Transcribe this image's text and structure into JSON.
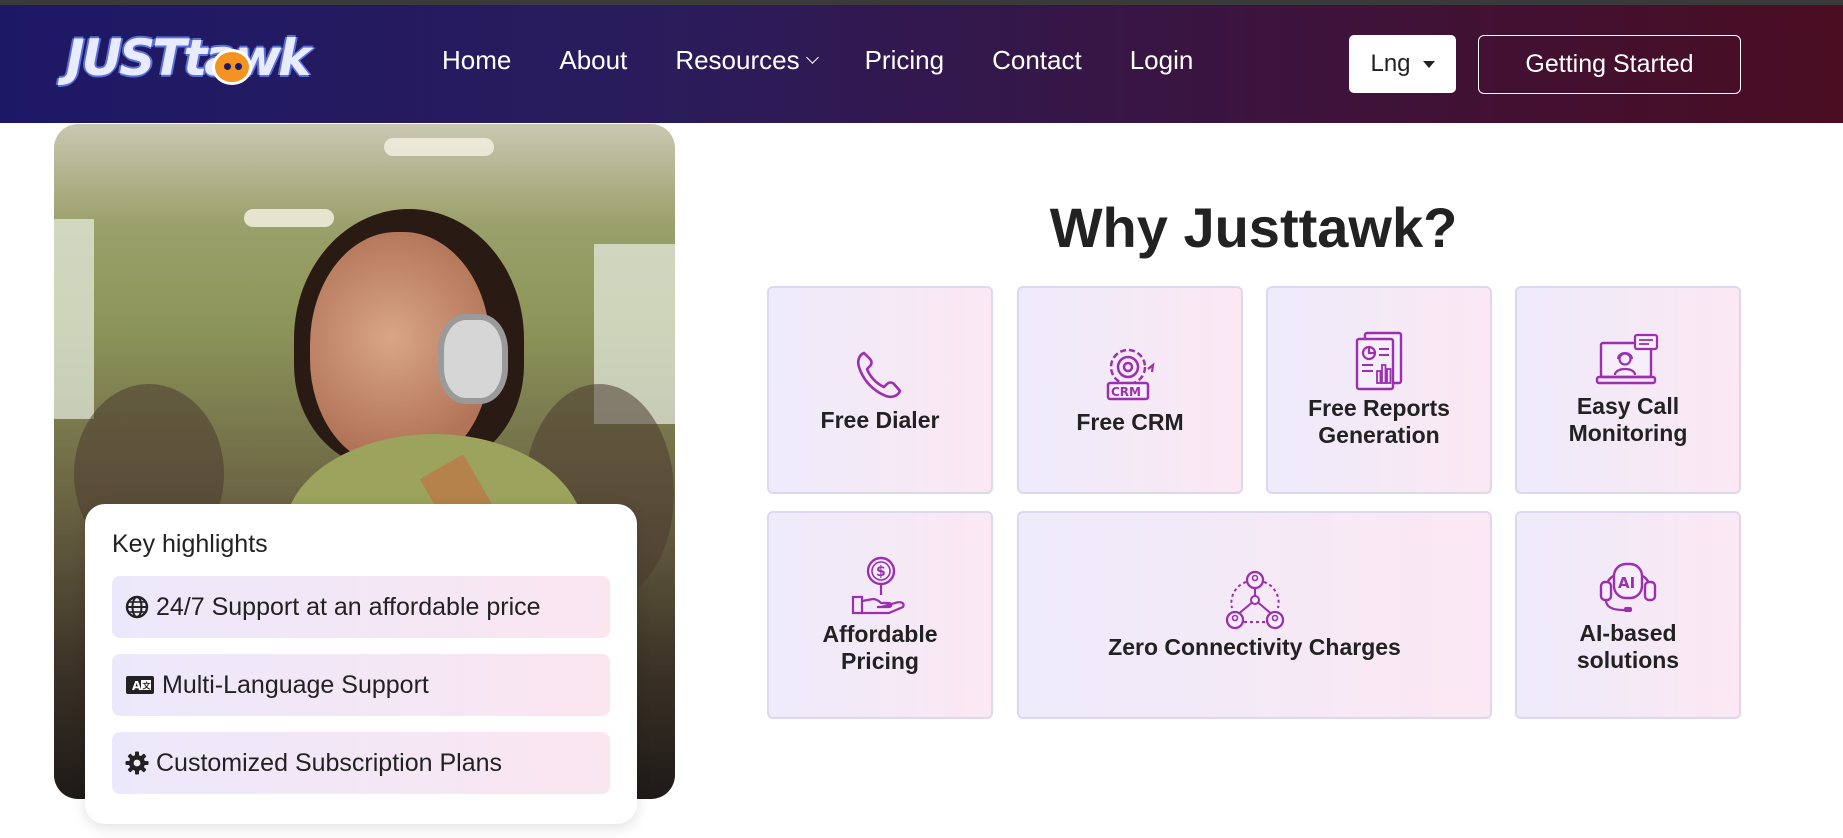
{
  "brand": {
    "logo_text": "JUSTtawk",
    "accent_gradient": [
      "#1d1866",
      "#4a0d22"
    ],
    "icon_color": "#9b2fae"
  },
  "nav": {
    "items": [
      {
        "label": "Home"
      },
      {
        "label": "About"
      },
      {
        "label": "Resources",
        "has_dropdown": true
      },
      {
        "label": "Pricing"
      },
      {
        "label": "Contact"
      },
      {
        "label": "Login"
      }
    ],
    "language_button": "Lng",
    "cta_button": "Getting Started"
  },
  "key_highlights": {
    "title": "Key highlights",
    "items": [
      {
        "icon": "globe-icon",
        "label": "24/7 Support at an affordable price"
      },
      {
        "icon": "language-card-icon",
        "label": "Multi-Language Support"
      },
      {
        "icon": "gear-icon",
        "label": "Customized Subscription Plans"
      }
    ]
  },
  "why": {
    "title": "Why Justtawk?",
    "features": [
      {
        "icon": "phone-icon",
        "label": "Free Dialer"
      },
      {
        "icon": "crm-gear-icon",
        "label": "Free CRM"
      },
      {
        "icon": "report-icon",
        "label": "Free Reports Generation"
      },
      {
        "icon": "monitor-call-icon",
        "label": "Easy Call Monitoring"
      },
      {
        "icon": "dollar-hand-icon",
        "label": "Affordable Pricing"
      },
      {
        "icon": "network-users-icon",
        "label": "Zero Connectivity Charges"
      },
      {
        "icon": "ai-headset-icon",
        "label": "AI-based solutions"
      }
    ]
  }
}
